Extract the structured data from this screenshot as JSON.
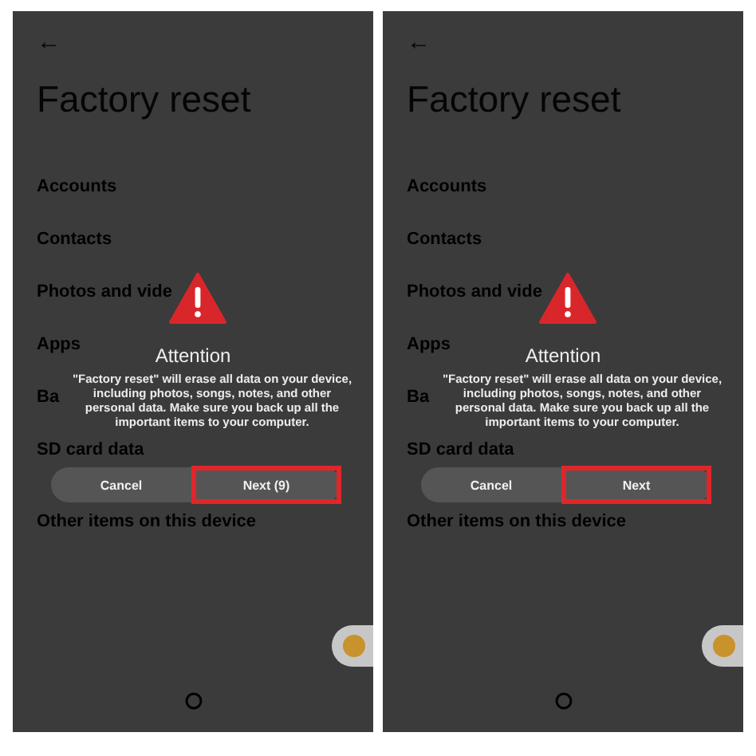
{
  "panels": [
    {
      "back": "←",
      "title": "Factory reset",
      "items": [
        "Accounts",
        "Contacts",
        "Photos and vide",
        "Apps",
        "Ba",
        "SD card data",
        "Other items on this device"
      ],
      "dialog": {
        "title": "Attention",
        "message": "\"Factory reset\" will erase all data on your device, including photos, songs, notes, and other personal data. Make sure you back up all the important items to your computer.",
        "buttons": [
          {
            "label": "Cancel",
            "highlighted": false
          },
          {
            "label": "Next (9)",
            "highlighted": true
          }
        ]
      }
    },
    {
      "back": "←",
      "title": "Factory reset",
      "items": [
        "Accounts",
        "Contacts",
        "Photos and vide",
        "Apps",
        "Ba",
        "SD card data",
        "Other items on this device"
      ],
      "dialog": {
        "title": "Attention",
        "message": "\"Factory reset\" will erase all data on your device, including photos, songs, notes, and other personal data. Make sure you back up all the important items to your computer.",
        "buttons": [
          {
            "label": "Cancel",
            "highlighted": false
          },
          {
            "label": "Next",
            "highlighted": true
          }
        ]
      }
    }
  ]
}
